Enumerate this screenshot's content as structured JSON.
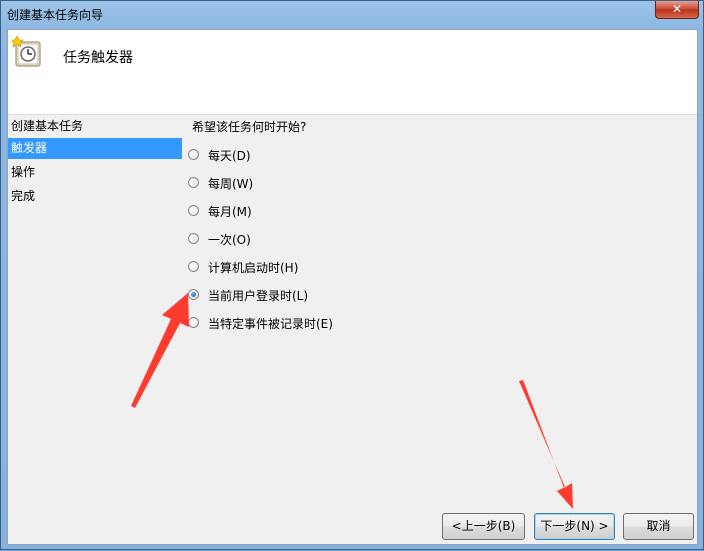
{
  "window": {
    "title": "创建基本任务向导",
    "close_label": "✕"
  },
  "header": {
    "title": "任务触发器"
  },
  "sidebar": {
    "items": [
      {
        "label": "创建基本任务",
        "selected": false
      },
      {
        "label": "触发器",
        "selected": true
      },
      {
        "label": "操作",
        "selected": false
      },
      {
        "label": "完成",
        "selected": false
      }
    ]
  },
  "main": {
    "question": "希望该任务何时开始?",
    "options": [
      {
        "label": "每天(D)",
        "checked": false
      },
      {
        "label": "每周(W)",
        "checked": false
      },
      {
        "label": "每月(M)",
        "checked": false
      },
      {
        "label": "一次(O)",
        "checked": false
      },
      {
        "label": "计算机启动时(H)",
        "checked": false
      },
      {
        "label": "当前用户登录时(L)",
        "checked": true
      },
      {
        "label": "当特定事件被记录时(E)",
        "checked": false
      }
    ]
  },
  "buttons": {
    "back": "<上一步(B)",
    "next": "下一步(N) >",
    "cancel": "取消"
  },
  "colors": {
    "selection": "#3399ff",
    "annotation_arrow": "#ff3b30"
  }
}
